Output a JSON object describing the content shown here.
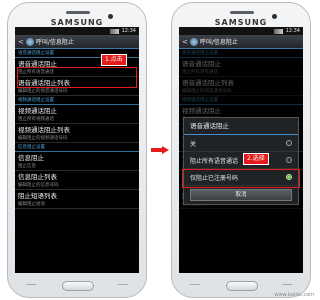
{
  "brand": "SAMSUNG",
  "status_time": "12:34",
  "left_screen": {
    "title": "呼叫/信息阻止",
    "sections": [
      {
        "header": "语音通话阻止设置",
        "items": [
          {
            "name": "语音通话阻止",
            "desc": "阻止所有语音通话"
          },
          {
            "name": "语音通话阻止列表",
            "desc": "编辑阻止的语音通话号码"
          }
        ]
      },
      {
        "header": "视频通话阻止设置",
        "items": [
          {
            "name": "视频通话阻止",
            "desc": "阻止所有视频通话"
          },
          {
            "name": "视频通话阻止列表",
            "desc": "编辑阻止的视频通话号码"
          }
        ]
      },
      {
        "header": "信息阻止设置",
        "items": [
          {
            "name": "信息阻止",
            "desc": "阻止信息"
          },
          {
            "name": "信息阻止列表",
            "desc": "编辑阻止的信息号码"
          },
          {
            "name": "阻止短语列表",
            "desc": "编辑阻止短语"
          }
        ]
      }
    ],
    "callout": "1.点击"
  },
  "right_screen": {
    "title": "呼叫/信息阻止",
    "dialog": {
      "title": "语音通话阻止",
      "options": [
        {
          "label": "关",
          "checked": false
        },
        {
          "label": "阻止所有语音通话",
          "checked": false
        },
        {
          "label": "仅阻止已注册号码",
          "checked": true
        }
      ],
      "cancel": "取消"
    },
    "callout": "2.选择"
  },
  "colors": {
    "highlight": "#e31b1b",
    "section_header": "#4fa3d6",
    "arrow": "#e31b1b"
  },
  "watermark": "www.baidu.com"
}
